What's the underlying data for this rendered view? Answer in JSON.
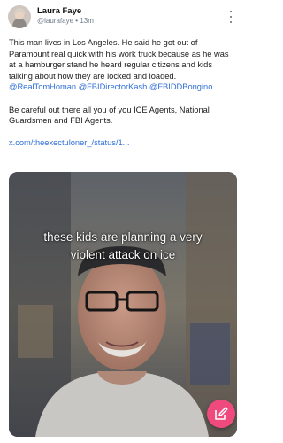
{
  "post": {
    "author_name": "Laura Faye",
    "handle": "@laurafaye",
    "separator": "•",
    "time": "13m",
    "text_part1": "This man lives in Los Angeles. He said he got out of Paramount real quick with his work truck because as he was at a hamburger stand he heard regular citizens and kids talking about how they are locked and loaded.",
    "mentions": [
      "@RealTomHoman",
      "@FBIDirectorKash",
      "@FBIDDBongino"
    ],
    "text_part2": "Be careful out there all you of you ICE Agents, National Guardsmen and FBI Agents.",
    "link_text": "x.com/theexectuloner_/status/1..."
  },
  "media": {
    "caption_line1": "these kids are planning a very",
    "caption_line2": "violent attack on ice"
  },
  "icons": {
    "more": "more-vertical-icon",
    "compose": "compose-icon"
  },
  "colors": {
    "link": "#2f6fd6",
    "fab": "#ee4a7d",
    "meta": "#6f7b8a"
  }
}
